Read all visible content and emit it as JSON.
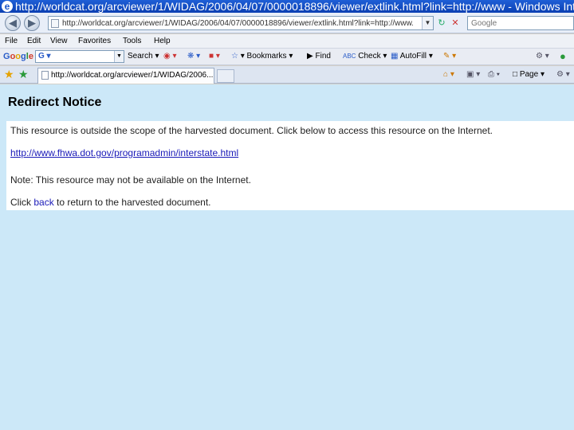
{
  "window": {
    "title": "http://worldcat.org/arcviewer/1/WIDAG/2006/04/07/0000018896/viewer/extlink.html?link=http://www - Windows Inter..."
  },
  "address": {
    "url": "http://worldcat.org/arcviewer/1/WIDAG/2006/04/07/0000018896/viewer/extlink.html?link=http://www.fhwa",
    "search_placeholder": "Google"
  },
  "menu": [
    "File",
    "Edit",
    "View",
    "Favorites",
    "Tools",
    "Help"
  ],
  "google_toolbar": {
    "logo": [
      "G",
      "o",
      "o",
      "g",
      "l",
      "e"
    ],
    "search_btn": "Search",
    "bookmarks": "Bookmarks",
    "find": "Find",
    "check": "Check",
    "autofill": "AutoFill"
  },
  "tab": {
    "label": "http://worldcat.org/arcviewer/1/WIDAG/2006..."
  },
  "commands": {
    "page": "Page",
    "tools": "Tools"
  },
  "page": {
    "heading": "Redirect Notice",
    "line1": "This resource is outside the scope of the harvested document. Click below to access this resource on the Internet.",
    "link": "http://www.fhwa.dot.gov/programadmin/interstate.html",
    "note": "Note: This resource may not be available on the Internet.",
    "click_prefix": "Click ",
    "back": "back",
    "click_suffix": " to return to the harvested document."
  }
}
